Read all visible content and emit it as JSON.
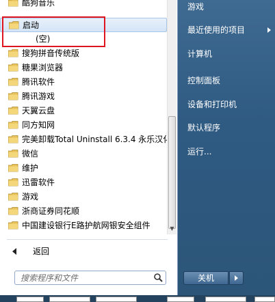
{
  "programs": [
    {
      "label": "酷狗音乐",
      "type": "folder"
    },
    {
      "label": "启动",
      "type": "folder",
      "selected": true
    },
    {
      "label": "(空)",
      "type": "empty"
    },
    {
      "label": "搜狗拼音传统版",
      "type": "folder"
    },
    {
      "label": "糖果浏览器",
      "type": "folder"
    },
    {
      "label": "腾讯软件",
      "type": "folder"
    },
    {
      "label": "腾讯游戏",
      "type": "folder"
    },
    {
      "label": "天翼云盘",
      "type": "folder"
    },
    {
      "label": "同方知网",
      "type": "folder"
    },
    {
      "label": "完美卸载Total Uninstall 6.3.4 永乐汉化",
      "type": "folder"
    },
    {
      "label": "微信",
      "type": "folder"
    },
    {
      "label": "维护",
      "type": "folder"
    },
    {
      "label": "迅雷软件",
      "type": "folder"
    },
    {
      "label": "游戏",
      "type": "folder"
    },
    {
      "label": "浙商证券同花顺",
      "type": "folder"
    },
    {
      "label": "中国建设银行E路护航网银安全组件",
      "type": "folder"
    }
  ],
  "back_label": "返回",
  "search": {
    "placeholder": "搜索程序和文件"
  },
  "right_items": [
    {
      "label": "游戏"
    },
    {
      "label": "最近使用的项目",
      "has_submenu": true
    },
    {
      "label": "计算机"
    },
    {
      "label": "控制面板"
    },
    {
      "label": "设备和打印机"
    },
    {
      "label": "默认程序"
    },
    {
      "label": "运行..."
    }
  ],
  "shutdown_label": "关机",
  "colors": {
    "highlight": "#e0141e",
    "folder": "#e8c25a",
    "right_panel": "#2f5a82"
  }
}
